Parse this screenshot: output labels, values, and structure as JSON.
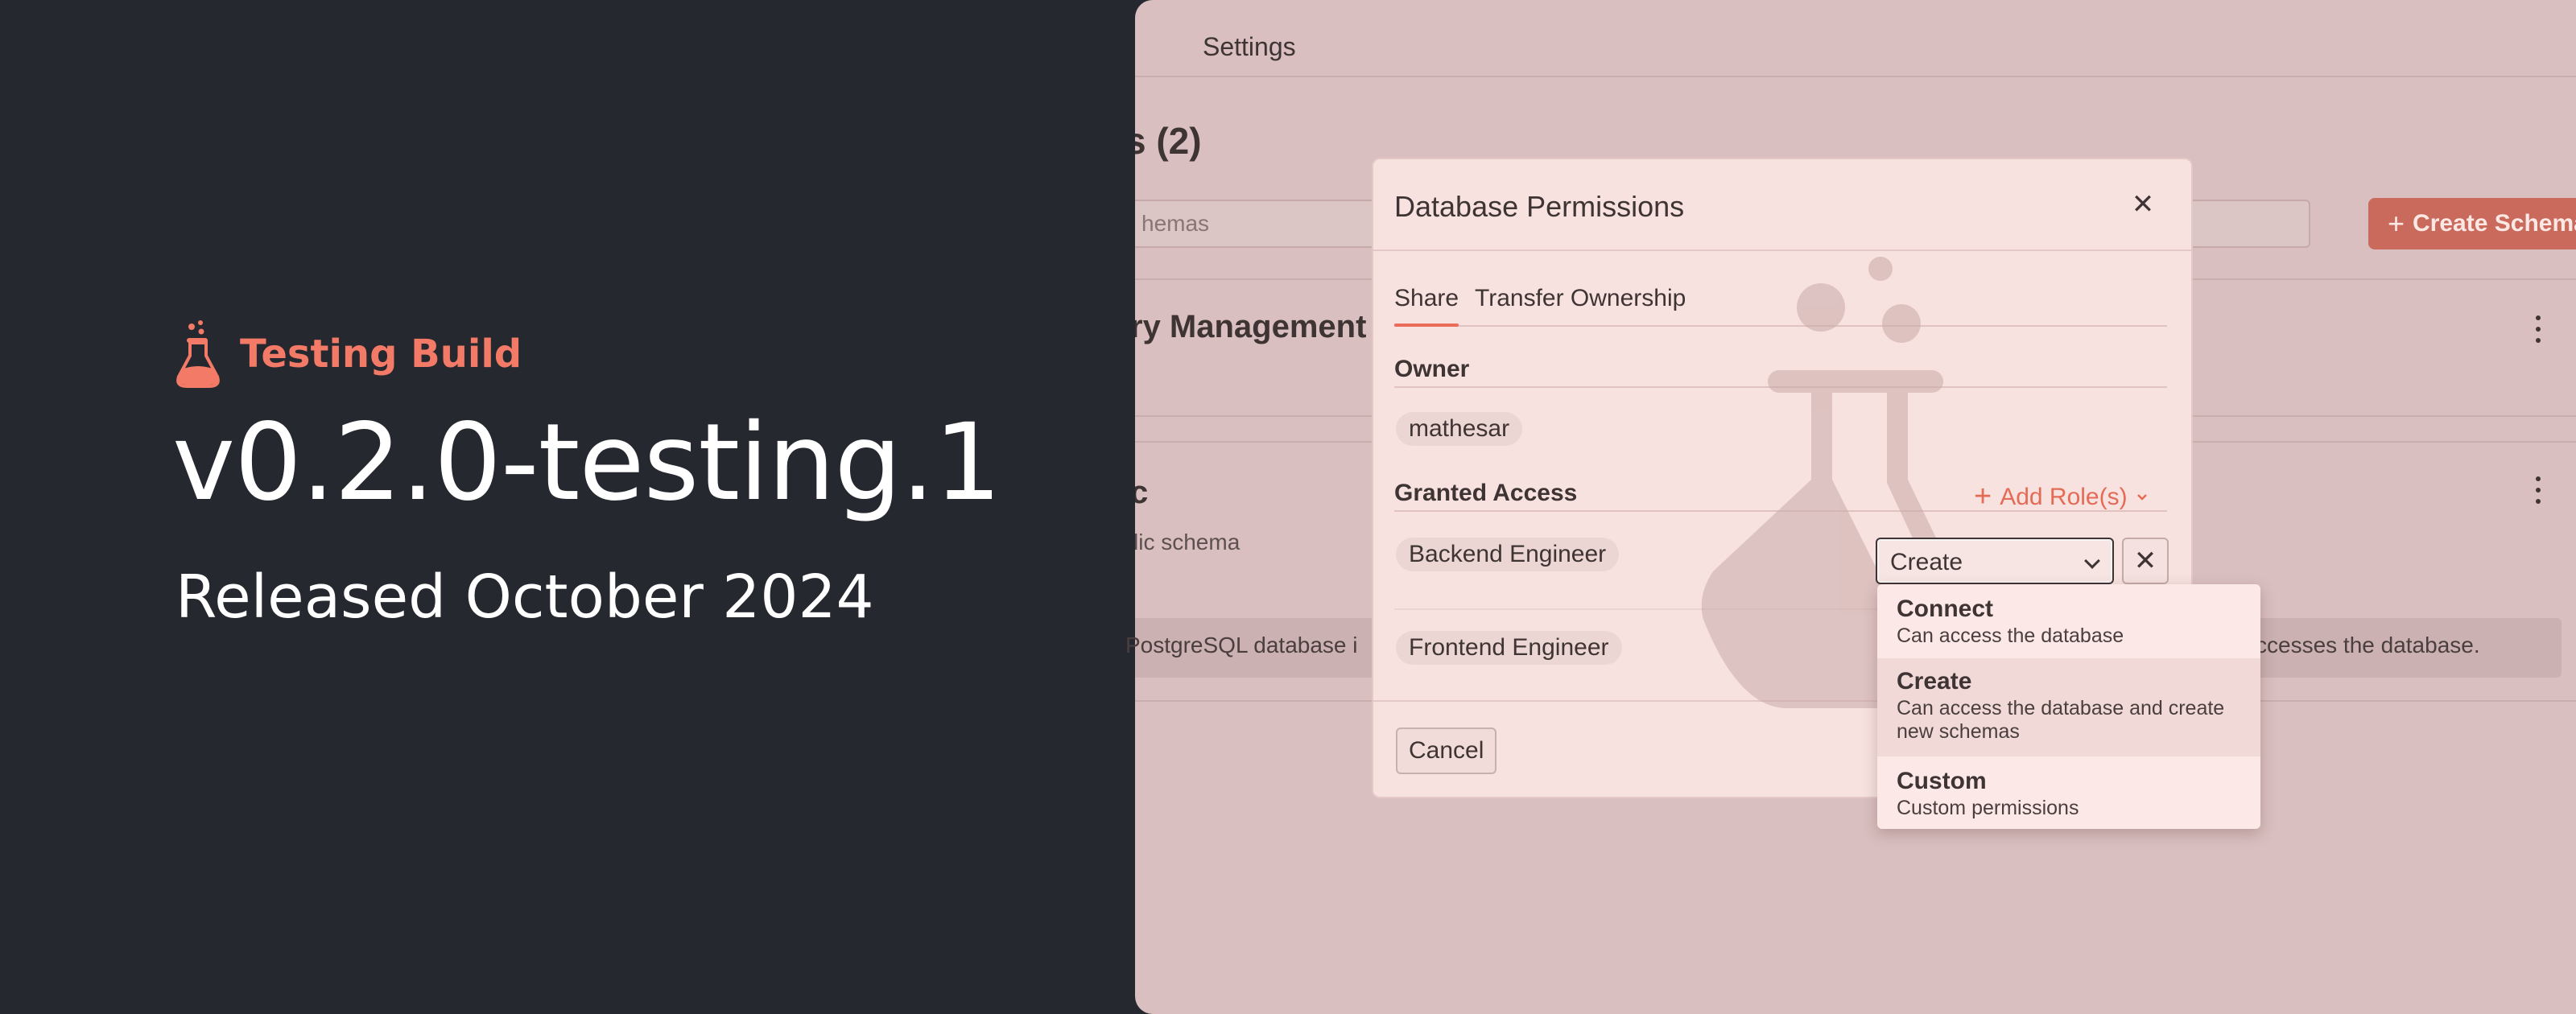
{
  "promo": {
    "badge_icon": "flask-icon",
    "badge_label": "Testing Build",
    "version": "v0.2.0-testing.1",
    "release_date": "Released October 2024",
    "accent_color": "#f27a66"
  },
  "app": {
    "nav": {
      "settings_tab": "Settings"
    },
    "schemas_heading": "s (2)",
    "search_placeholder": "hemas",
    "create_schema_label": "Create Schema",
    "cards": [
      {
        "title": "ry Management",
        "subtitle": ""
      },
      {
        "title": "c",
        "subtitle": "lic schema"
      }
    ],
    "info_banner": {
      "left_text": "PostgreSQL database i",
      "right_text": "ccesses the database."
    }
  },
  "modal": {
    "title": "Database Permissions",
    "tabs": [
      {
        "label": "Share",
        "active": true
      },
      {
        "label": "Transfer Ownership",
        "active": false
      }
    ],
    "owner_label": "Owner",
    "owner_name": "mathesar",
    "granted_access_label": "Granted Access",
    "add_roles_label": "Add Role(s)",
    "roles": [
      {
        "name": "Backend Engineer",
        "permission": "Create"
      },
      {
        "name": "Frontend Engineer"
      }
    ],
    "cancel_label": "Cancel"
  },
  "permission_dropdown": {
    "selected": "Create",
    "options": [
      {
        "title": "Connect",
        "description": [
          "Can access the database"
        ]
      },
      {
        "title": "Create",
        "description": [
          "Can access the database and create",
          "new schemas"
        ],
        "highlighted": true
      },
      {
        "title": "Custom",
        "description": [
          "Custom permissions"
        ]
      }
    ]
  }
}
